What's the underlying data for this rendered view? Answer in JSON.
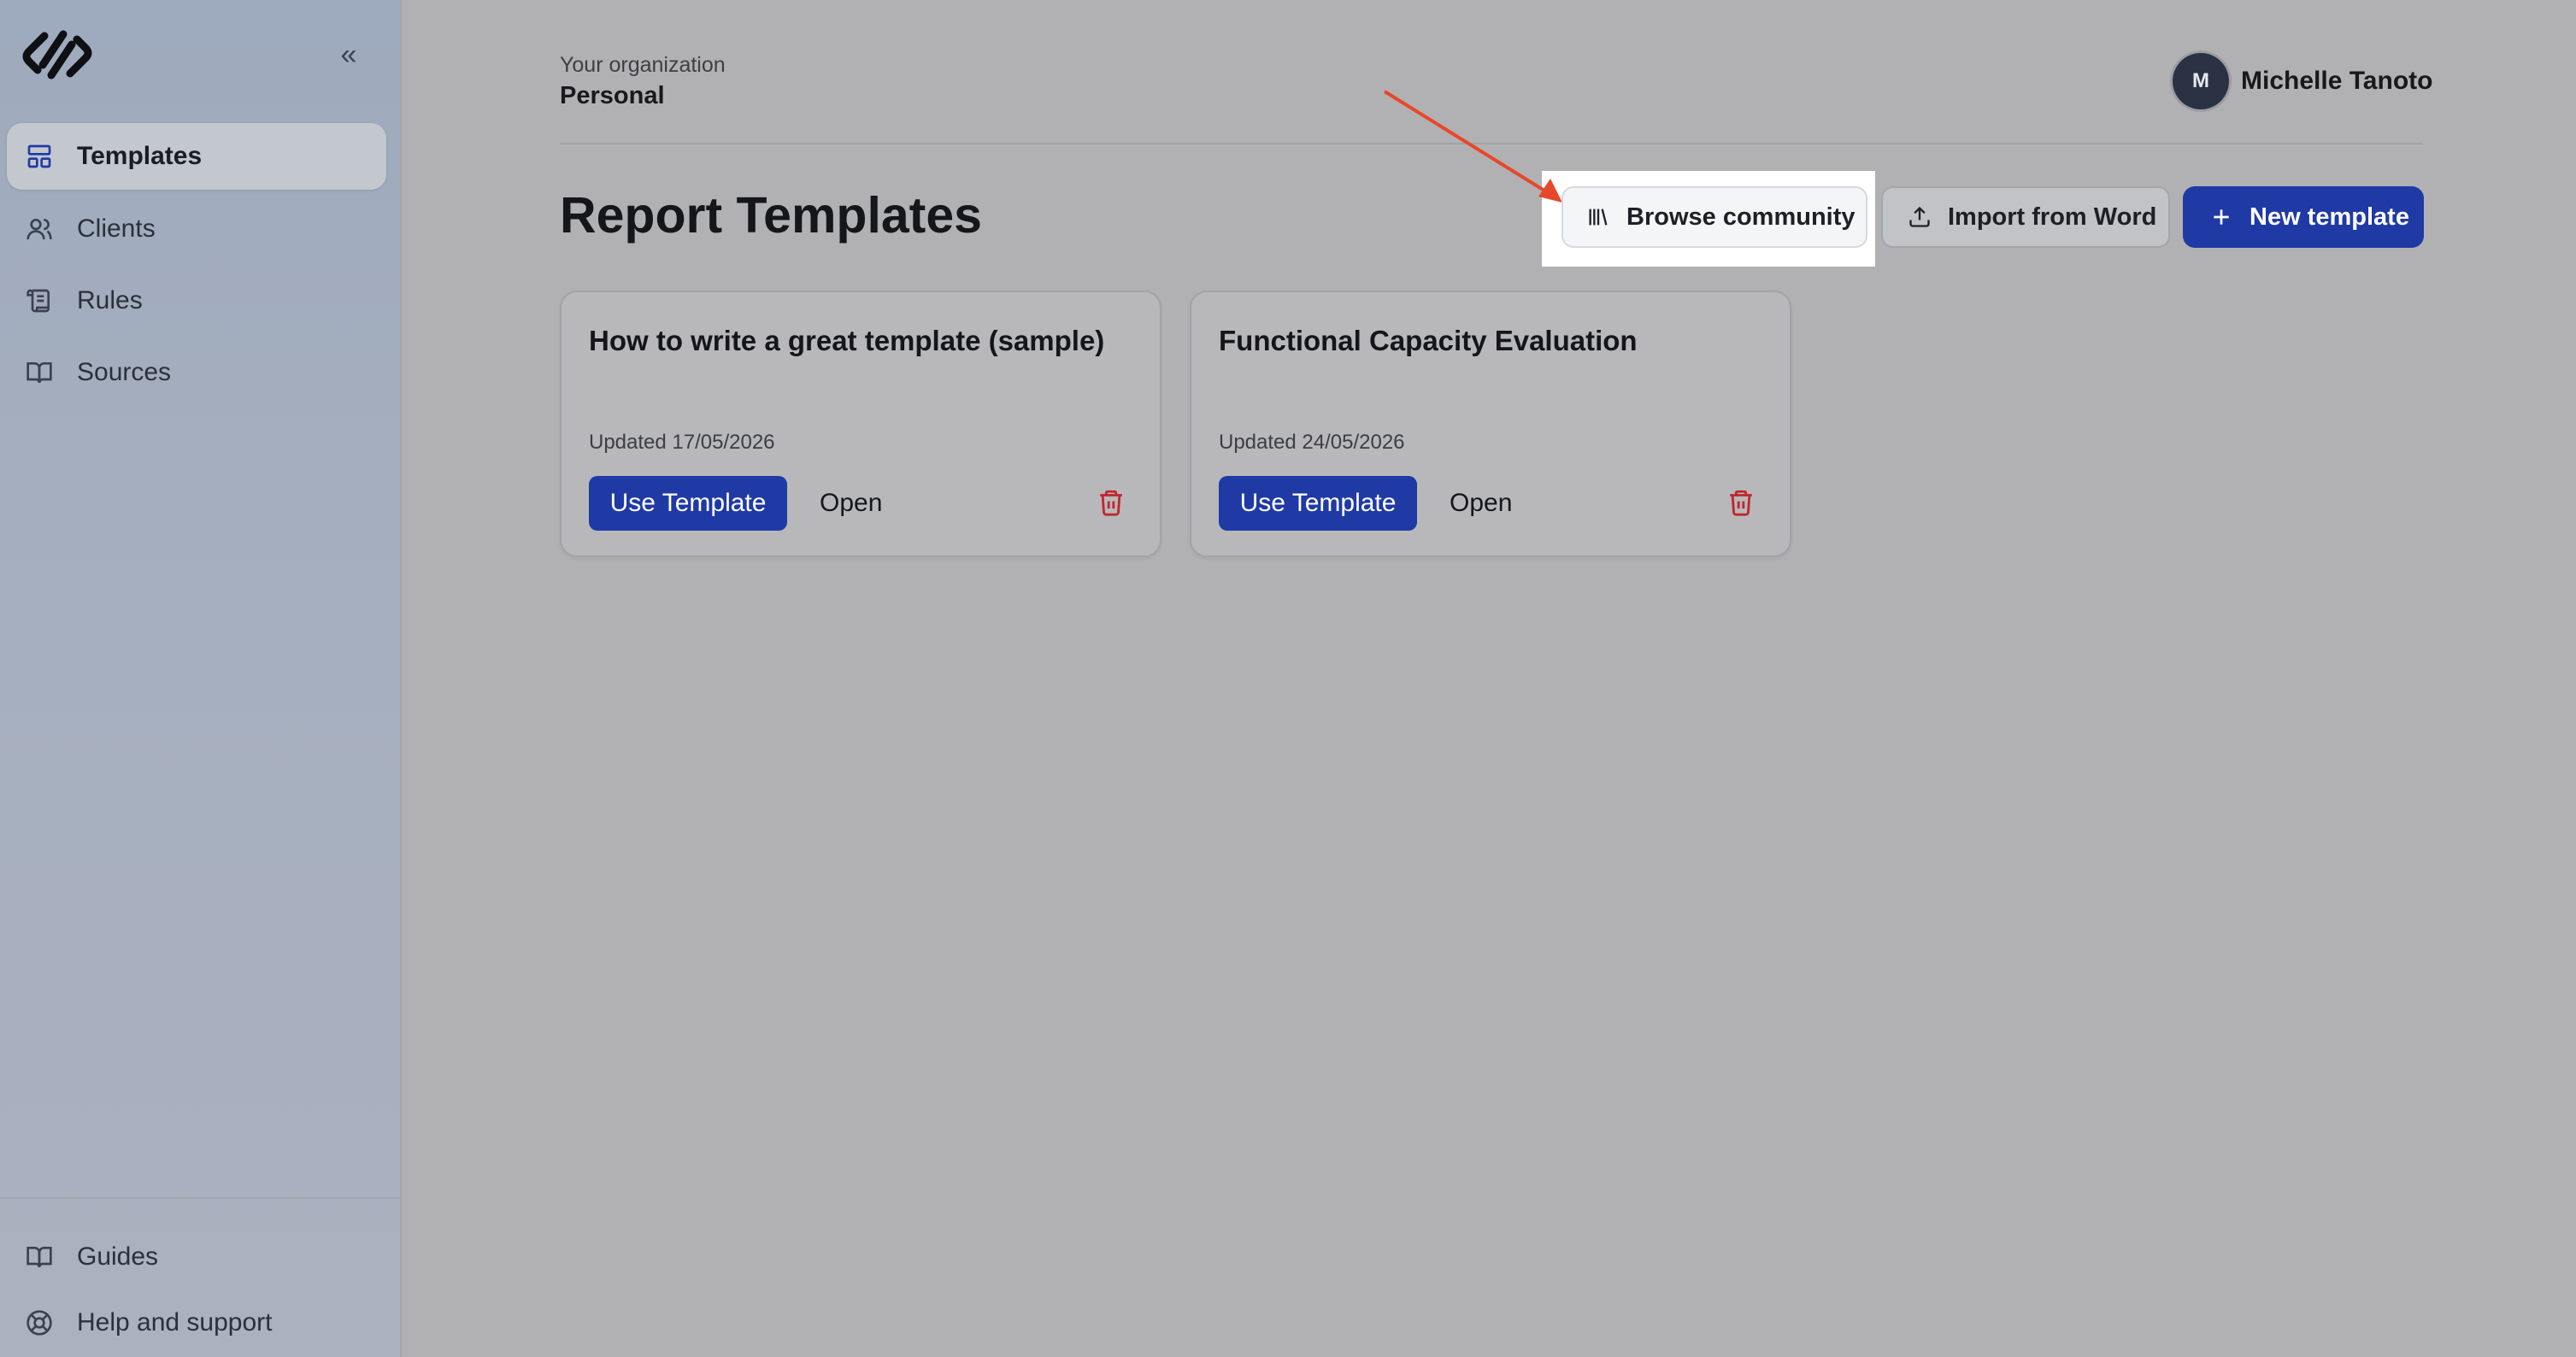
{
  "sidebar": {
    "collapse_glyph": "«",
    "items": [
      {
        "label": "Templates",
        "icon": "layout-icon",
        "active": true
      },
      {
        "label": "Clients",
        "icon": "users-icon",
        "active": false
      },
      {
        "label": "Rules",
        "icon": "scroll-icon",
        "active": false
      },
      {
        "label": "Sources",
        "icon": "book-open-icon",
        "active": false
      }
    ],
    "footer_items": [
      {
        "label": "Guides",
        "icon": "book-open-icon"
      },
      {
        "label": "Help and support",
        "icon": "lifebuoy-icon"
      }
    ]
  },
  "header": {
    "org_label": "Your organization",
    "org_name": "Personal",
    "user": {
      "initial": "M",
      "name": "Michelle Tanoto"
    }
  },
  "main": {
    "title": "Report Templates",
    "actions": {
      "browse": "Browse community",
      "import": "Import from Word",
      "new": "New template"
    },
    "cards": [
      {
        "title": "How to write a great template (sample)",
        "updated": "Updated 17/05/2026",
        "use": "Use Template",
        "open": "Open"
      },
      {
        "title": "Functional Capacity Evaluation",
        "updated": "Updated 24/05/2026",
        "use": "Use Template",
        "open": "Open"
      }
    ]
  },
  "colors": {
    "primary": "#1f3aa5",
    "danger": "#c0262d",
    "annotation_arrow": "#e8472b",
    "sidebar_bg": "#9eaabd"
  }
}
